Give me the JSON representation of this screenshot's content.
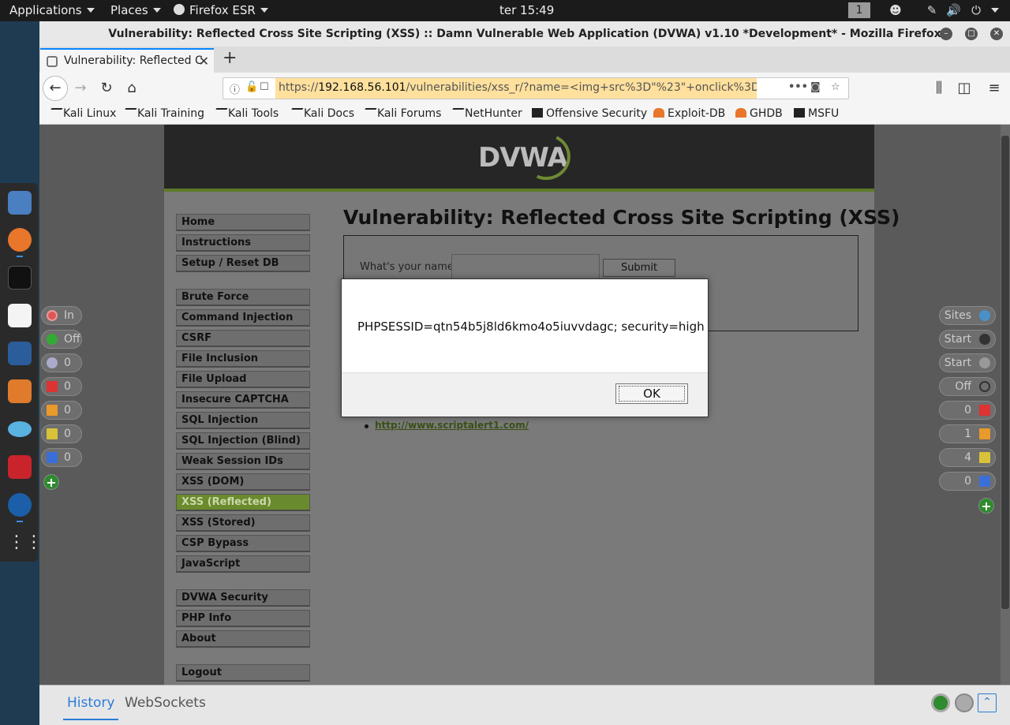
{
  "topbar": {
    "applications": "Applications",
    "places": "Places",
    "firefox": "Firefox ESR",
    "clock": "ter 15:49",
    "workspace": "1"
  },
  "window": {
    "title": "Vulnerability: Reflected Cross Site Scripting (XSS) :: Damn Vulnerable Web Application (DVWA) v1.10 *Development* - Mozilla Firefox"
  },
  "tabs": [
    {
      "label": "Vulnerability: Reflected C"
    }
  ],
  "urlbar": {
    "scheme": "https://",
    "host": "192.168.56.101",
    "path": "/vulnerabilities/xss_r/?name=<img+src%3D\"%23\"+onclick%3Dalert"
  },
  "bookmarks": [
    "Kali Linux",
    "Kali Training",
    "Kali Tools",
    "Kali Docs",
    "Kali Forums",
    "NetHunter",
    "Offensive Security",
    "Exploit-DB",
    "GHDB",
    "MSFU"
  ],
  "dvwa": {
    "logo": "DVWA",
    "menu_group1": [
      "Home",
      "Instructions",
      "Setup / Reset DB"
    ],
    "menu_group2": [
      "Brute Force",
      "Command Injection",
      "CSRF",
      "File Inclusion",
      "File Upload",
      "Insecure CAPTCHA",
      "SQL Injection",
      "SQL Injection (Blind)",
      "Weak Session IDs",
      "XSS (DOM)",
      "XSS (Reflected)",
      "XSS (Stored)",
      "CSP Bypass",
      "JavaScript"
    ],
    "menu_group3": [
      "DVWA Security",
      "PHP Info",
      "About"
    ],
    "menu_group4": [
      "Logout"
    ],
    "active_item": "XSS (Reflected)",
    "title": "Vulnerability: Reflected Cross Site Scripting (XSS)",
    "form_label": "What's your name?",
    "submit_label": "Submit",
    "ref_link": "http://www.scriptalert1.com/"
  },
  "hud_left": [
    {
      "label": "In",
      "icon": "target-icon"
    },
    {
      "label": "Off",
      "icon": "green-dot-icon"
    },
    {
      "label": "0",
      "icon": "lightbulb-icon"
    },
    {
      "label": "0",
      "icon": "red-flag-icon"
    },
    {
      "label": "0",
      "icon": "orange-flag-icon"
    },
    {
      "label": "0",
      "icon": "yellow-flag-icon"
    },
    {
      "label": "0",
      "icon": "blue-flag-icon"
    }
  ],
  "hud_right": [
    {
      "label": "Sites",
      "icon": "globe-icon"
    },
    {
      "label": "Start",
      "icon": "spider-icon"
    },
    {
      "label": "Start",
      "icon": "fire-icon"
    },
    {
      "label": "Off",
      "icon": "crosshair-icon"
    },
    {
      "label": "0",
      "icon": "red-flag-icon"
    },
    {
      "label": "1",
      "icon": "orange-flag-icon"
    },
    {
      "label": "4",
      "icon": "yellow-flag-icon"
    },
    {
      "label": "0",
      "icon": "blue-flag-icon"
    }
  ],
  "drawer": {
    "tab_history": "History",
    "tab_websockets": "WebSockets"
  },
  "alert": {
    "message": "PHPSESSID=qtn54b5j8ld6kmo4o5iuvvdagc; security=high",
    "ok": "OK"
  },
  "colors": {
    "dvwa_green": "#6a8a2e",
    "url_highlight": "#ffc64d",
    "firefox_accent": "#0a84ff"
  }
}
